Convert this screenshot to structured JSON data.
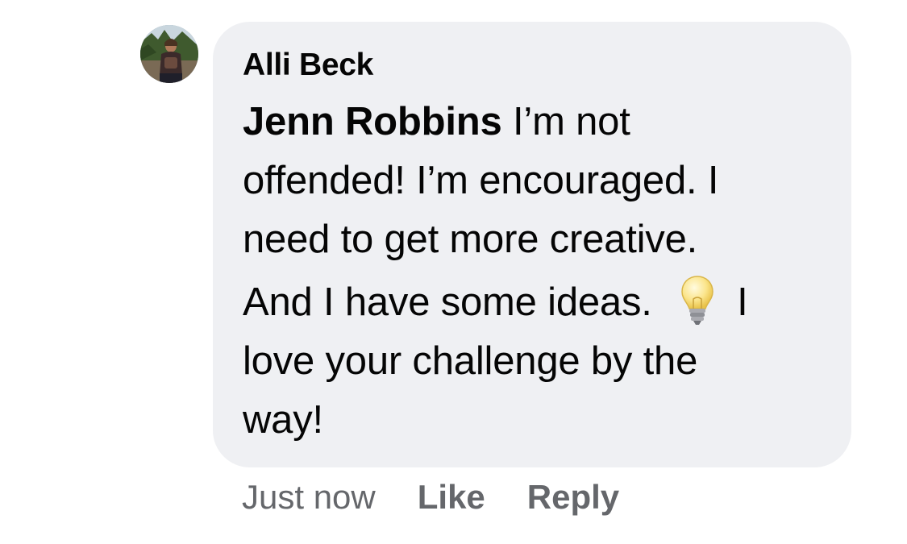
{
  "comment": {
    "author": "Alli Beck",
    "mention": "Jenn Robbins",
    "lines": [
      " I’m not",
      "offended! I’m encouraged. I",
      "need to get more creative.",
      "And I have some ideas.",
      " I",
      "love your challenge by the",
      "way!"
    ],
    "inline_icon": "light-bulb-emoji"
  },
  "actions": {
    "timestamp": "Just now",
    "like_label": "Like",
    "reply_label": "Reply"
  },
  "colors": {
    "bubble_background": "#eff0f3",
    "text": "#050505",
    "secondary_text": "#65676b"
  },
  "avatar_icon": "profile-photo-avatar"
}
